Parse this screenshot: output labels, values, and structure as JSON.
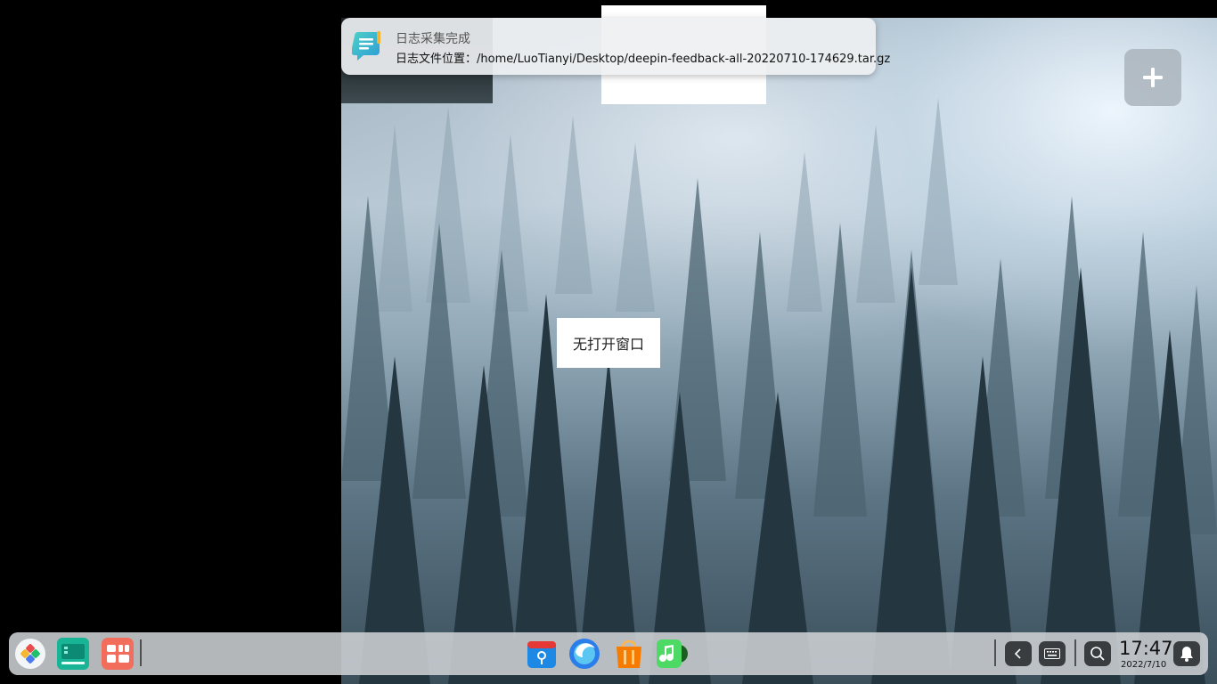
{
  "notification": {
    "title": "日志采集完成",
    "body": "日志文件位置：/home/LuoTianyi/Desktop/deepin-feedback-all-20220710-174629.tar.gz",
    "icon": "log-collector-icon"
  },
  "workspace": {
    "empty_label": "无打开窗口",
    "add_icon": "plus-icon"
  },
  "dock": {
    "left_apps": [
      {
        "name": "launcher",
        "icon": "launcher-icon"
      },
      {
        "name": "multitasking-view",
        "icon": "multitask-icon"
      },
      {
        "name": "app-grid",
        "icon": "app-grid-icon"
      }
    ],
    "center_apps": [
      {
        "name": "file-manager",
        "icon": "file-manager-icon"
      },
      {
        "name": "browser",
        "icon": "browser-icon"
      },
      {
        "name": "app-store",
        "icon": "app-store-icon"
      },
      {
        "name": "music",
        "icon": "music-icon"
      }
    ],
    "tray": [
      {
        "name": "collapse-tray",
        "icon": "chevron-left-icon"
      },
      {
        "name": "onscreen-keyboard",
        "icon": "keyboard-icon"
      },
      {
        "name": "search",
        "icon": "search-icon"
      },
      {
        "name": "notification-center",
        "icon": "bell-icon"
      }
    ],
    "clock": {
      "time": "17:47",
      "date": "2022/7/10"
    }
  }
}
